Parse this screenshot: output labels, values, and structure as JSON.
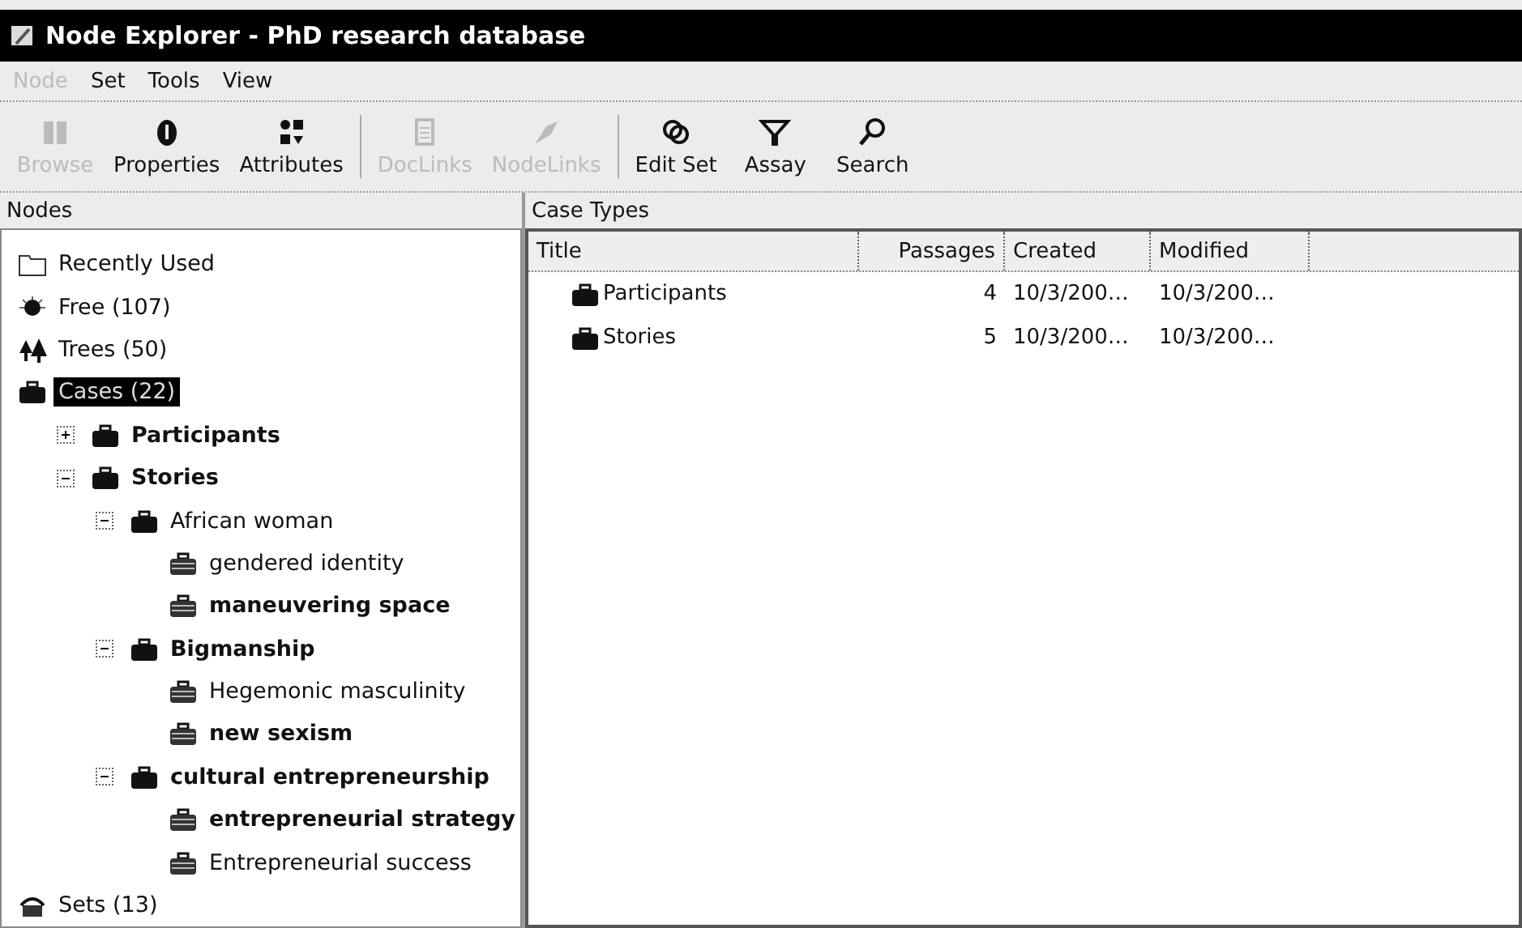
{
  "window": {
    "title": "Node Explorer - PhD research database"
  },
  "menu": [
    {
      "label": "Node",
      "disabled": true
    },
    {
      "label": "Set",
      "disabled": false
    },
    {
      "label": "Tools",
      "disabled": false
    },
    {
      "label": "View",
      "disabled": false
    }
  ],
  "toolbar": [
    {
      "label": "Browse",
      "kind": "browse",
      "disabled": true,
      "separator_before": false
    },
    {
      "label": "Properties",
      "kind": "properties",
      "disabled": false,
      "separator_before": false
    },
    {
      "label": "Attributes",
      "kind": "attributes",
      "disabled": false,
      "separator_before": false
    },
    {
      "label": "DocLinks",
      "kind": "doclinks",
      "disabled": true,
      "separator_before": true
    },
    {
      "label": "NodeLinks",
      "kind": "nodelinks",
      "disabled": true,
      "separator_before": false
    },
    {
      "label": "Edit Set",
      "kind": "editset",
      "disabled": false,
      "separator_before": true
    },
    {
      "label": "Assay",
      "kind": "assay",
      "disabled": false,
      "separator_before": false
    },
    {
      "label": "Search",
      "kind": "search",
      "disabled": false,
      "separator_before": false
    }
  ],
  "nodes": {
    "title": "Nodes",
    "tree": [
      {
        "label": "Recently Used",
        "kind": "folder",
        "bold": false,
        "selected": false
      },
      {
        "label": "Free (107)",
        "kind": "free",
        "bold": false,
        "selected": false
      },
      {
        "label": "Trees (50)",
        "kind": "trees",
        "bold": false,
        "selected": false
      },
      {
        "label": "Cases (22)",
        "kind": "case",
        "bold": false,
        "selected": true,
        "children": [
          {
            "label": "Participants",
            "kind": "case",
            "bold": true,
            "selected": false,
            "expanded": false
          },
          {
            "label": "Stories",
            "kind": "case",
            "bold": true,
            "selected": false,
            "expanded": true,
            "children": [
              {
                "label": "African woman",
                "kind": "case",
                "bold": false,
                "selected": false,
                "expanded": true,
                "children": [
                  {
                    "label": "gendered identity",
                    "kind": "leaf",
                    "bold": false,
                    "selected": false
                  },
                  {
                    "label": "maneuvering space",
                    "kind": "leaf",
                    "bold": true,
                    "selected": false
                  }
                ]
              },
              {
                "label": "Bigmanship",
                "kind": "case",
                "bold": true,
                "selected": false,
                "expanded": true,
                "children": [
                  {
                    "label": "Hegemonic masculinity",
                    "kind": "leaf",
                    "bold": false,
                    "selected": false
                  },
                  {
                    "label": "new sexism",
                    "kind": "leaf",
                    "bold": true,
                    "selected": false
                  }
                ]
              },
              {
                "label": "cultural entrepreneurship",
                "kind": "case",
                "bold": true,
                "selected": false,
                "expanded": true,
                "children": [
                  {
                    "label": "entrepreneurial strategy",
                    "kind": "leaf",
                    "bold": true,
                    "selected": false
                  },
                  {
                    "label": "Entrepreneurial success",
                    "kind": "leaf",
                    "bold": false,
                    "selected": false
                  }
                ]
              }
            ]
          }
        ]
      },
      {
        "label": "Sets (13)",
        "kind": "sets",
        "bold": false,
        "selected": false
      }
    ]
  },
  "case_types": {
    "title": "Case Types",
    "columns": [
      "Title",
      "Passages",
      "Created",
      "Modified"
    ],
    "rows": [
      {
        "title": "Participants",
        "passages": "4",
        "created": "10/3/200…",
        "modified": "10/3/200…"
      },
      {
        "title": "Stories",
        "passages": "5",
        "created": "10/3/200…",
        "modified": "10/3/200…"
      }
    ]
  }
}
